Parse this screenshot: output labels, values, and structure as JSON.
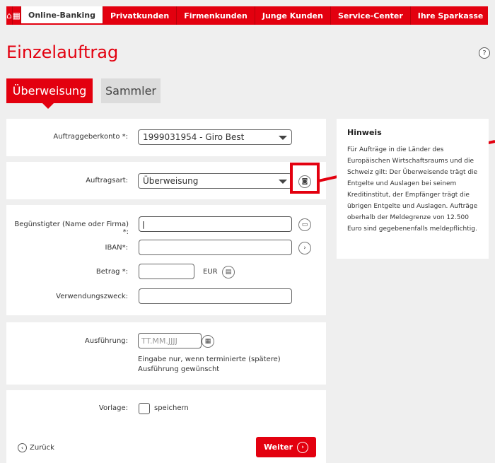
{
  "nav": {
    "items": [
      {
        "label": "Online-Banking"
      },
      {
        "label": "Privatkunden"
      },
      {
        "label": "Firmenkunden"
      },
      {
        "label": "Junge Kunden"
      },
      {
        "label": "Service-Center"
      },
      {
        "label": "Ihre Sparkasse"
      }
    ]
  },
  "page": {
    "title": "Einzelauftrag",
    "help": "?"
  },
  "tabs": {
    "active": "Überweisung",
    "inactive": "Sammler"
  },
  "form": {
    "auftraggeberkonto_label": "Auftraggeberkonto *:",
    "auftraggeberkonto_value": "1999031954 - Giro Best",
    "auftragsart_label": "Auftragsart:",
    "auftragsart_value": "Überweisung",
    "beguenstigter_label": "Begünstigter (Name oder Firma) *:",
    "iban_label": "IBAN*:",
    "betrag_label": "Betrag *:",
    "currency": "EUR",
    "verwendungszweck_label": "Verwendungszweck:",
    "ausfuehrung_label": "Ausführung:",
    "ausfuehrung_placeholder": "TT.MM.JJJJ",
    "ausfuehrung_hint": "Eingabe nur, wenn terminierte (spätere) Ausführung gewünscht",
    "vorlage_label": "Vorlage:",
    "vorlage_checkbox_label": "speichern",
    "back_label": "Zurück",
    "next_label": "Weiter"
  },
  "hinweis": {
    "title": "Hinweis",
    "text": "Für Aufträge in die Länder des Europäischen Wirtschaftsraums und die Schweiz gilt: Der Überweisende trägt die Entgelte und Auslagen bei seinem Kreditinstitut, der Empfänger trägt die übrigen Entgelte und Auslagen. Aufträge oberhalb der Meldegrenze von 12.500 Euro sind gegebenenfalls meldepflichtig."
  }
}
